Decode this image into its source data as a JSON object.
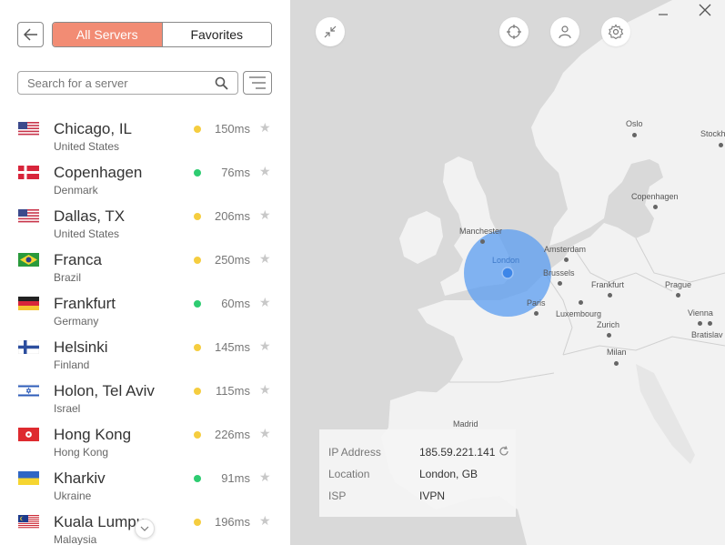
{
  "tabs": {
    "all_servers": "All Servers",
    "favorites": "Favorites"
  },
  "search": {
    "placeholder": "Search for a server"
  },
  "servers": [
    {
      "city": "Chicago, IL",
      "country": "United States",
      "ping": "150ms",
      "status": "yellow"
    },
    {
      "city": "Copenhagen",
      "country": "Denmark",
      "ping": "76ms",
      "status": "green"
    },
    {
      "city": "Dallas, TX",
      "country": "United States",
      "ping": "206ms",
      "status": "yellow"
    },
    {
      "city": "Franca",
      "country": "Brazil",
      "ping": "250ms",
      "status": "yellow"
    },
    {
      "city": "Frankfurt",
      "country": "Germany",
      "ping": "60ms",
      "status": "green"
    },
    {
      "city": "Helsinki",
      "country": "Finland",
      "ping": "145ms",
      "status": "yellow"
    },
    {
      "city": "Holon, Tel Aviv",
      "country": "Israel",
      "ping": "115ms",
      "status": "yellow"
    },
    {
      "city": "Hong Kong",
      "country": "Hong Kong",
      "ping": "226ms",
      "status": "yellow"
    },
    {
      "city": "Kharkiv",
      "country": "Ukraine",
      "ping": "91ms",
      "status": "green"
    },
    {
      "city": "Kuala Lumpu",
      "country": "Malaysia",
      "ping": "196ms",
      "status": "yellow"
    }
  ],
  "status_colors": {
    "green": "#2ecc71",
    "yellow": "#f5cd3f"
  },
  "accent": "#f28c74",
  "map": {
    "cities": {
      "oslo": "Oslo",
      "stockholm": "Stockh",
      "copenhagen": "Copenhagen",
      "manchester": "Manchester",
      "amsterdam": "Amsterdam",
      "london": "London",
      "brussels": "Brussels",
      "frankfurt": "Frankfurt",
      "prague": "Prague",
      "paris": "Paris",
      "luxembourg": "Luxembourg",
      "zurich": "Zurich",
      "vienna": "Vienna",
      "bratislava": "Bratislav",
      "milan": "Milan",
      "madrid": "Madrid"
    },
    "connection_color": "#5a9cf0"
  },
  "info": {
    "ip_label": "IP Address",
    "ip_value": "185.59.221.141",
    "location_label": "Location",
    "location_value": "London, GB",
    "isp_label": "ISP",
    "isp_value": "IVPN"
  },
  "icons": {
    "back": "arrow-left-icon",
    "search": "search-icon",
    "filter": "filter-icon",
    "star": "star-icon",
    "collapse": "collapse-icon",
    "locate": "crosshair-icon",
    "account": "user-icon",
    "settings": "gear-icon",
    "close": "close-icon",
    "minimize": "minimize-icon"
  }
}
